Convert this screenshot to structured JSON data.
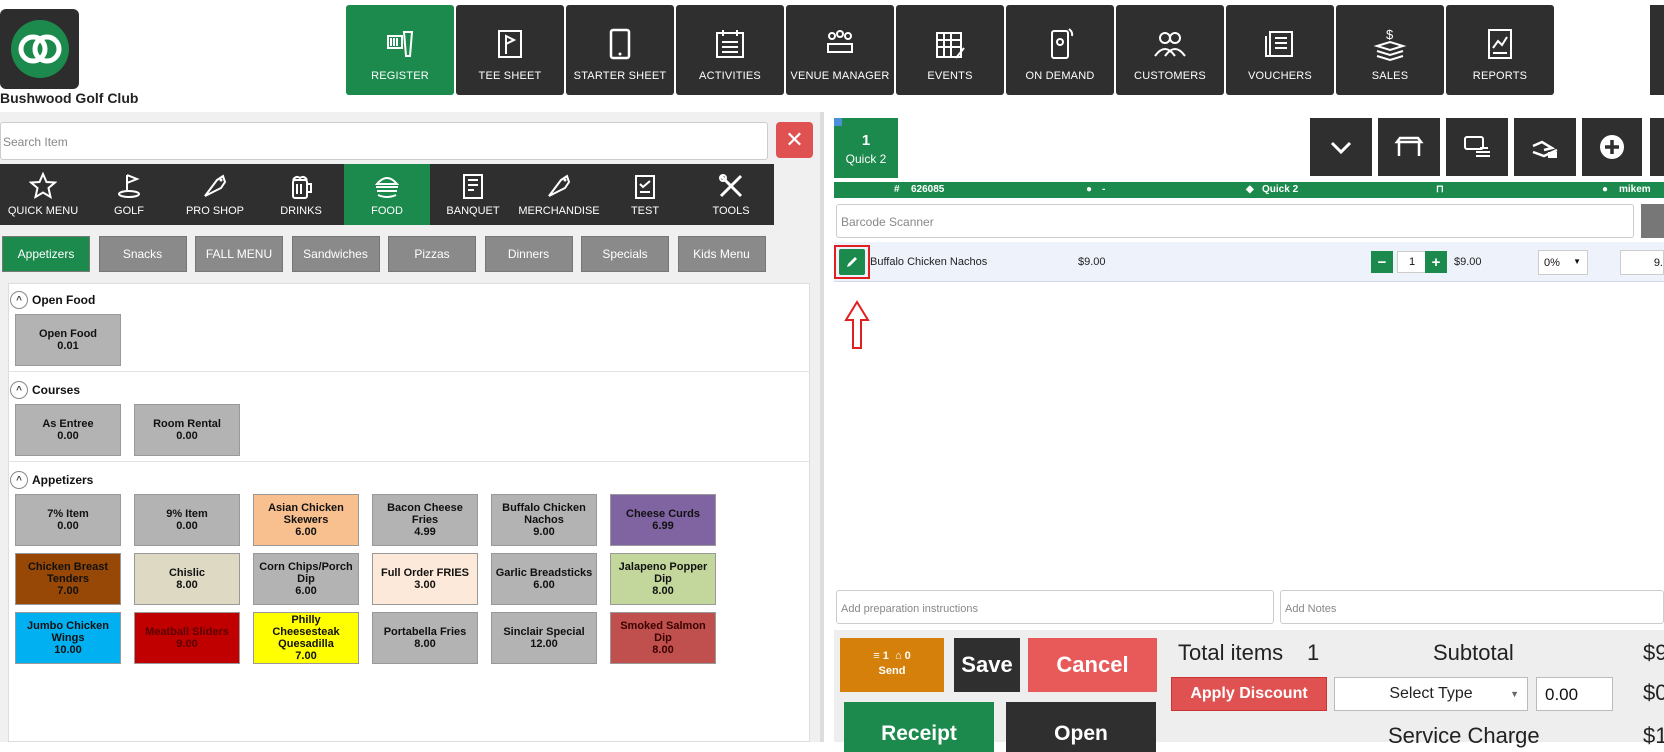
{
  "header": {
    "club_name": "Bushwood Golf Club",
    "nav": [
      {
        "label": "REGISTER",
        "icon": "scanner-icon",
        "active": true
      },
      {
        "label": "TEE SHEET",
        "icon": "flag-icon"
      },
      {
        "label": "STARTER SHEET",
        "icon": "tablet-icon"
      },
      {
        "label": "ACTIVITIES",
        "icon": "calendar-list-icon"
      },
      {
        "label": "VENUE MANAGER",
        "icon": "meeting-icon"
      },
      {
        "label": "EVENTS",
        "icon": "calendar-edit-icon"
      },
      {
        "label": "ON DEMAND",
        "icon": "phone-icon"
      },
      {
        "label": "CUSTOMERS",
        "icon": "users-icon"
      },
      {
        "label": "VOUCHERS",
        "icon": "voucher-icon"
      },
      {
        "label": "SALES",
        "icon": "money-icon"
      },
      {
        "label": "REPORTS",
        "icon": "report-icon"
      }
    ]
  },
  "search": {
    "placeholder": "Search Item",
    "clear_label": "✕"
  },
  "categories": [
    {
      "label": "QUICK MENU",
      "icon": "star-icon"
    },
    {
      "label": "GOLF",
      "icon": "golf-icon"
    },
    {
      "label": "PRO SHOP",
      "icon": "tag-icon"
    },
    {
      "label": "DRINKS",
      "icon": "beer-icon"
    },
    {
      "label": "FOOD",
      "icon": "burger-icon",
      "active": true
    },
    {
      "label": "BANQUET",
      "icon": "document-icon"
    },
    {
      "label": "MERCHANDISE",
      "icon": "tag-icon"
    },
    {
      "label": "TEST",
      "icon": "clipboard-icon"
    },
    {
      "label": "TOOLS",
      "icon": "tools-icon"
    }
  ],
  "subcategories": [
    {
      "label": "Appetizers",
      "active": true
    },
    {
      "label": "Snacks"
    },
    {
      "label": "FALL MENU"
    },
    {
      "label": "Sandwiches"
    },
    {
      "label": "Pizzas"
    },
    {
      "label": "Dinners"
    },
    {
      "label": "Specials"
    },
    {
      "label": "Kids Menu"
    }
  ],
  "sections": [
    {
      "title": "Open Food",
      "collapse_icon": "^",
      "items": [
        {
          "name": "Open Food",
          "price": "0.01",
          "color": "#b3b3b3"
        }
      ]
    },
    {
      "title": "Courses",
      "collapse_icon": "^",
      "items": [
        {
          "name": "As Entree",
          "price": "0.00",
          "color": "#b3b3b3"
        },
        {
          "name": "Room Rental",
          "price": "0.00",
          "color": "#b3b3b3"
        }
      ]
    },
    {
      "title": "Appetizers",
      "collapse_icon": "^",
      "items": [
        {
          "name": "7% Item",
          "price": "0.00",
          "color": "#b3b3b3"
        },
        {
          "name": "9% Item",
          "price": "0.00",
          "color": "#b3b3b3"
        },
        {
          "name": "Asian Chicken Skewers",
          "price": "6.00",
          "color": "#f9c08f"
        },
        {
          "name": "Bacon Cheese Fries",
          "price": "4.99",
          "color": "#b3b3b3"
        },
        {
          "name": "Buffalo Chicken Nachos",
          "price": "9.00",
          "color": "#b3b3b3"
        },
        {
          "name": "Cheese Curds",
          "price": "6.99",
          "color": "#8064a2"
        },
        {
          "name": "Chicken Breast Tenders",
          "price": "7.00",
          "color": "#974806"
        },
        {
          "name": "Chislic",
          "price": "8.00",
          "color": "#ddd9c3"
        },
        {
          "name": "Corn Chips/Porch Dip",
          "price": "6.00",
          "color": "#b3b3b3"
        },
        {
          "name": "Full Order FRIES",
          "price": "3.00",
          "color": "#fde9d9"
        },
        {
          "name": "Garlic Breadsticks",
          "price": "6.00",
          "color": "#b3b3b3"
        },
        {
          "name": "Jalapeno Popper Dip",
          "price": "8.00",
          "color": "#c3d69b"
        },
        {
          "name": "Jumbo Chicken Wings",
          "price": "10.00",
          "color": "#00b0f0"
        },
        {
          "name": "Meatball Sliders",
          "price": "9.00",
          "color": "#c00000"
        },
        {
          "name": "Philly Cheesesteak Quesadilla",
          "price": "7.00",
          "color": "#ffff00"
        },
        {
          "name": "Portabella Fries",
          "price": "8.00",
          "color": "#b3b3b3"
        },
        {
          "name": "Sinclair Special",
          "price": "12.00",
          "color": "#b3b3b3"
        },
        {
          "name": "Smoked Salmon Dip",
          "price": "8.00",
          "color": "#c0504d"
        }
      ]
    }
  ],
  "ticket": {
    "number": "1",
    "label": "Quick 2",
    "info": {
      "ticket_id": "626085",
      "customer": "-",
      "tag": "Quick 2",
      "user": "mikem"
    },
    "barcode_placeholder": "Barcode Scanner",
    "line": {
      "name": "Buffalo Chicken Nachos",
      "price": "$9.00",
      "qty": "1",
      "ext": "$9.00",
      "discount": "0%",
      "total": "9."
    },
    "prep_placeholder": "Add preparation instructions",
    "notes_placeholder": "Add Notes"
  },
  "footer": {
    "send_count": "1",
    "send_count2": "0",
    "send_label": "Send",
    "save": "Save",
    "cancel": "Cancel",
    "receipt": "Receipt",
    "open": "Open",
    "total_items_label": "Total items",
    "total_items": "1",
    "subtotal_label": "Subtotal",
    "subtotal_value": "$9",
    "apply_discount": "Apply Discount",
    "select_type": "Select Type",
    "discount_amount": "0.00",
    "discount_value": "$0",
    "service_charge_label": "Service Charge",
    "service_charge_value": "$1"
  },
  "colors": {
    "brand_green": "#1b8a4c",
    "dark": "#2f2f2f",
    "danger": "#e05252",
    "send_orange": "#d4800a"
  }
}
